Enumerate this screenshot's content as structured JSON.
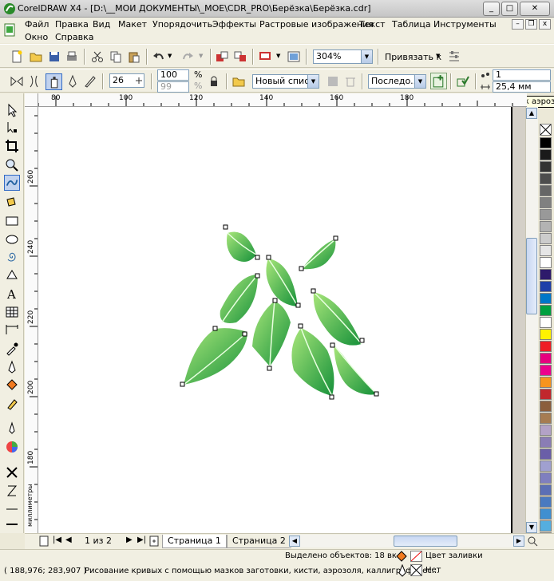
{
  "window": {
    "title": "CorelDRAW X4 - [D:\\__МОИ ДОКУМЕНТЫ\\_МОЕ\\CDR_PRO\\Берёзка\\Берёзка.cdr]",
    "minimize": "_",
    "maximize": "□",
    "close": "✕"
  },
  "menu": {
    "items": [
      "Файл",
      "Правка",
      "Вид",
      "Макет",
      "Упорядочить",
      "Эффекты",
      "Растровые изображения",
      "Текст",
      "Таблица",
      "Инструменты",
      "Окно",
      "Справка"
    ],
    "mdi_minimize": "–",
    "mdi_restore": "❐",
    "mdi_close": "x"
  },
  "toolbar_standard": {
    "zoom_value": "304%",
    "snap_label": "Привязать к"
  },
  "toolbar_property": {
    "nib_size": "26",
    "spray_amount_1": "100",
    "spray_amount_2": "99",
    "percent": "%",
    "spray_list": "Новый списс...",
    "spray_order": "Последо...",
    "dabs_value": "1",
    "spacing_value": "25,4 мм",
    "tooltip": "Добавить в список аэрозолей"
  },
  "rulers": {
    "horizontal": [
      "80",
      "100",
      "120",
      "140",
      "160",
      "180"
    ],
    "vertical": [
      "260",
      "240",
      "220",
      "200",
      "180"
    ],
    "units": "миллиметры"
  },
  "palette": {
    "colors": [
      "#000000",
      "#1a1a1a",
      "#333333",
      "#4d4d4d",
      "#666666",
      "#808080",
      "#999999",
      "#b3b3b3",
      "#cccccc",
      "#e6e6e6",
      "#ffffff",
      "#2e1a6b",
      "#1f3fa8",
      "#0077c8",
      "#00a040",
      "#ffffff",
      "#fff200",
      "#ee1c25",
      "#e6007e",
      "#ec008c",
      "#f7941d",
      "#c1272d",
      "#8b5e3c",
      "#a67c52",
      "#b3a2c7",
      "#8a7db5",
      "#6a5ea8",
      "#a0a0d0",
      "#7f7fbf",
      "#5b6fb5",
      "#4a7ac0",
      "#3f8fd0",
      "#55aee0",
      "#8fc8e8"
    ]
  },
  "page_nav": {
    "counter": "1 из 2",
    "tabs": [
      "Страница 1",
      "Страница 2"
    ]
  },
  "status": {
    "selected": "Выделено объектов: 18 вк...",
    "coords": "( 188,976; 283,907 )",
    "hint": "Рисование кривых с помощью мазков заготовки, кисти, аэрозоля, каллиграфичес...",
    "fill_label": "Цвет заливки",
    "outline_label": "Нет"
  },
  "colors": {
    "leaf_light": "#8fdc6a",
    "leaf_dark": "#1f9a3c",
    "leaf_vein": "#e8ffe0"
  }
}
